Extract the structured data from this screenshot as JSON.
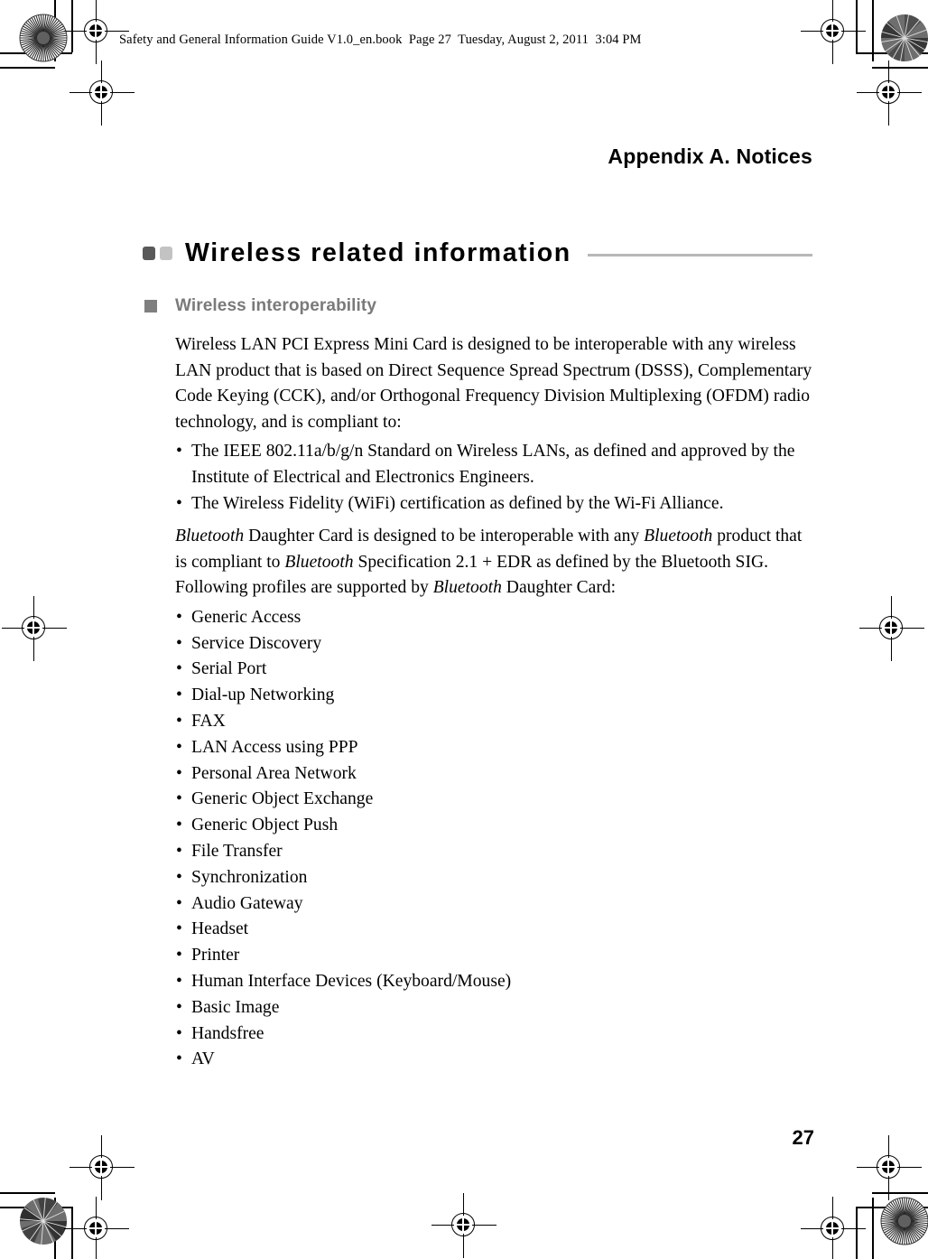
{
  "document": {
    "file_header": "Safety and General Information Guide V1.0_en.book  Page 27  Tuesday, August 2, 2011  3:04 PM",
    "running_title": "Appendix A. Notices",
    "page_number": "27"
  },
  "section": {
    "title": "Wireless related information",
    "marker_dark_color": "#595959",
    "marker_light_color": "#c3c3c3",
    "rule_color": "#b7b7b7"
  },
  "subsection": {
    "title": "Wireless interoperability",
    "title_color": "#7a7a7a",
    "bullet_color": "#7f7f7f"
  },
  "paragraphs": {
    "wlan_intro": "Wireless LAN PCI Express Mini Card is designed to be interoperable with any wireless LAN product that is based on Direct Sequence Spread Spectrum (DSSS), Complementary Code Keying (CCK), and/or Orthogonal Frequency Division Multiplexing (OFDM) radio technology, and is compliant to:",
    "bluetooth_intro_part1": "Bluetooth",
    "bluetooth_intro_part2": " Daughter Card is designed to be interoperable with any ",
    "bluetooth_intro_part3": "Bluetooth",
    "bluetooth_intro_part4": " product that is compliant to ",
    "bluetooth_intro_part5": "Bluetooth",
    "bluetooth_intro_part6": " Specification 2.1 + EDR as defined by the Bluetooth SIG. Following profiles are supported by ",
    "bluetooth_intro_part7": "Bluetooth",
    "bluetooth_intro_part8": " Daughter Card:"
  },
  "standards_list": [
    "The IEEE 802.11a/b/g/n Standard on Wireless LANs, as defined and approved by the Institute of Electrical and Electronics Engineers.",
    "The Wireless Fidelity (WiFi) certification as defined by the Wi-Fi Alliance."
  ],
  "bluetooth_profiles": [
    "Generic Access",
    "Service Discovery",
    "Serial Port",
    "Dial-up Networking",
    "FAX",
    "LAN Access using PPP",
    "Personal Area Network",
    "Generic Object Exchange",
    "Generic Object Push",
    "File Transfer",
    "Synchronization",
    "Audio Gateway",
    "Headset",
    "Printer",
    "Human Interface Devices (Keyboard/Mouse)",
    "Basic Image",
    "Handsfree",
    "AV"
  ]
}
